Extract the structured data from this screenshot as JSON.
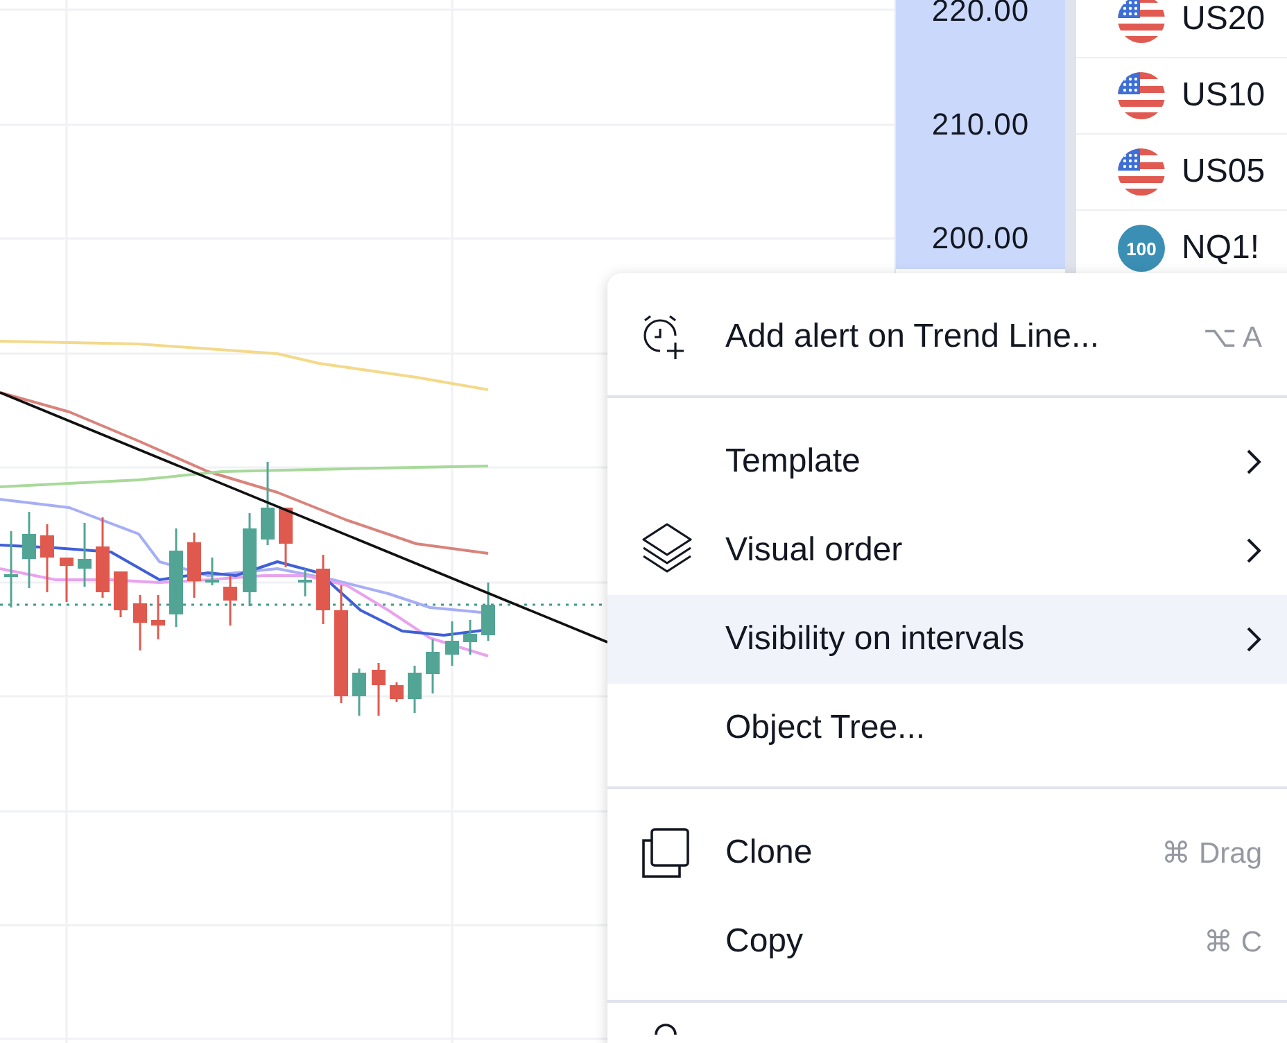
{
  "price_axis": {
    "labels": [
      "220.00",
      "210.00",
      "200.00"
    ]
  },
  "watchlist": {
    "rows": [
      {
        "kind": "flag",
        "symbol": "US20"
      },
      {
        "kind": "flag",
        "symbol": "US10"
      },
      {
        "kind": "flag",
        "symbol": "US05"
      },
      {
        "kind": "badge",
        "badge": "100",
        "symbol": "NQ1!"
      }
    ]
  },
  "context_menu": {
    "items": [
      {
        "kind": "item",
        "label": "Add alert on Trend Line...",
        "shortcut": "⌥ A",
        "submenu": false,
        "selected": false
      },
      {
        "kind": "divider"
      },
      {
        "kind": "item",
        "label": "Template",
        "submenu": true,
        "selected": false
      },
      {
        "kind": "item",
        "label": "Visual order",
        "submenu": true,
        "selected": false
      },
      {
        "kind": "item",
        "label": "Visibility on intervals",
        "submenu": true,
        "selected": true
      },
      {
        "kind": "item",
        "label": "Object Tree...",
        "submenu": false,
        "selected": false
      },
      {
        "kind": "divider"
      },
      {
        "kind": "item",
        "label": "Clone",
        "shortcut": "⌘ Drag",
        "submenu": false,
        "selected": false
      },
      {
        "kind": "item",
        "label": "Copy",
        "shortcut": "⌘ C",
        "submenu": false,
        "selected": false
      },
      {
        "kind": "divider"
      },
      {
        "kind": "partial"
      }
    ]
  }
}
